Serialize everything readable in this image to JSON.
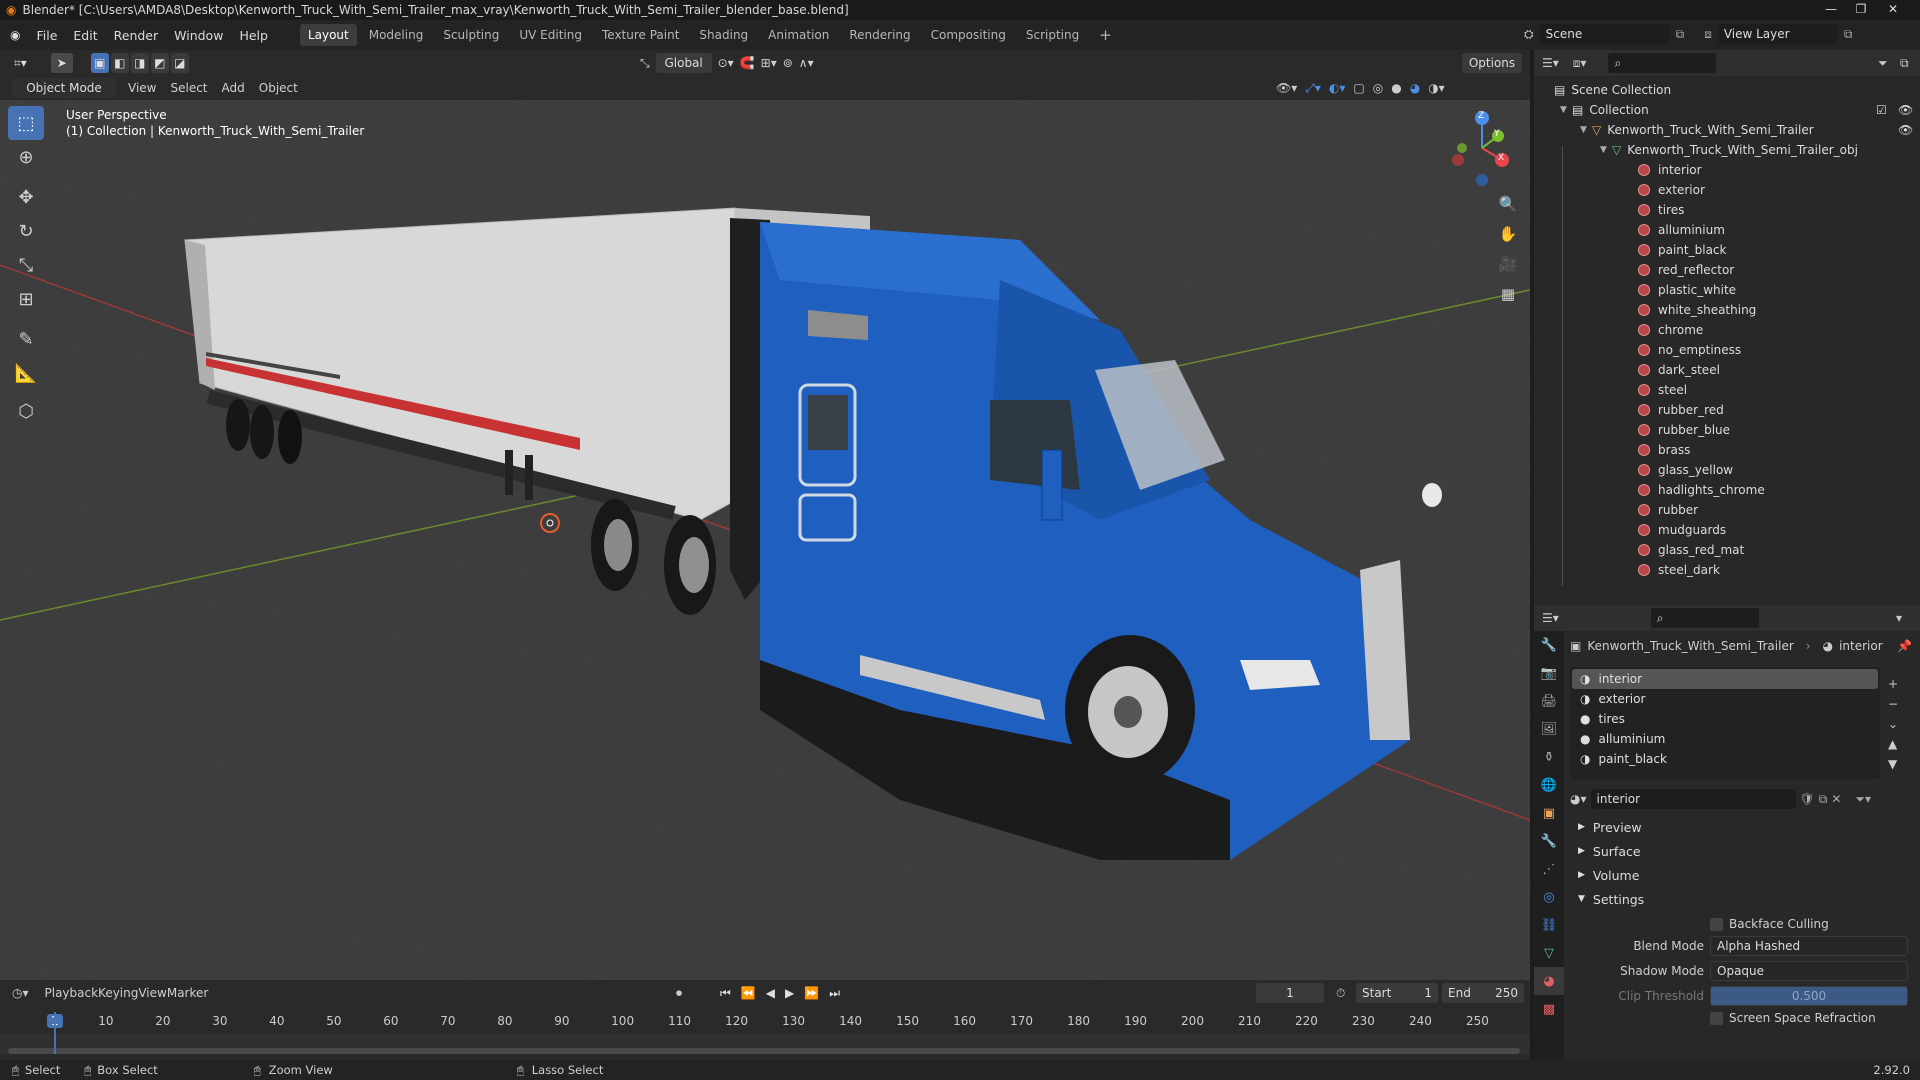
{
  "window": {
    "title": "Blender* [C:\\Users\\AMDA8\\Desktop\\Kenworth_Truck_With_Semi_Trailer_max_vray\\Kenworth_Truck_With_Semi_Trailer_blender_base.blend]"
  },
  "menu": {
    "items": [
      "File",
      "Edit",
      "Render",
      "Window",
      "Help"
    ]
  },
  "workspaces": [
    "Layout",
    "Modeling",
    "Sculpting",
    "UV Editing",
    "Texture Paint",
    "Shading",
    "Animation",
    "Rendering",
    "Compositing",
    "Scripting"
  ],
  "scene": {
    "label": "Scene",
    "view_layer": "View Layer"
  },
  "viewport_header": {
    "transform": "Global",
    "options": "Options",
    "mode": "Object Mode",
    "menus": [
      "View",
      "Select",
      "Add",
      "Object"
    ]
  },
  "viewport": {
    "perspective": "User Perspective",
    "collection": "(1) Collection | Kenworth_Truck_With_Semi_Trailer",
    "axes": {
      "x": "X",
      "y": "Y",
      "z": "Z"
    }
  },
  "outliner": {
    "root": "Scene Collection",
    "collection": "Collection",
    "object": "Kenworth_Truck_With_Semi_Trailer",
    "mesh": "Kenworth_Truck_With_Semi_Trailer_obj",
    "materials": [
      "interior",
      "exterior",
      "tires",
      "alluminium",
      "paint_black",
      "red_reflector",
      "plastic_white",
      "white_sheathing",
      "chrome",
      "no_emptiness",
      "dark_steel",
      "steel",
      "rubber_red",
      "rubber_blue",
      "brass",
      "glass_yellow",
      "hadlights_chrome",
      "rubber",
      "mudguards",
      "glass_red_mat",
      "steel_dark"
    ]
  },
  "properties": {
    "breadcrumb_object": "Kenworth_Truck_With_Semi_Trailer",
    "breadcrumb_material": "interior",
    "slots": [
      "interior",
      "exterior",
      "tires",
      "alluminium",
      "paint_black"
    ],
    "material_name": "interior",
    "panels": {
      "preview": "Preview",
      "surface": "Surface",
      "volume": "Volume",
      "settings": "Settings"
    },
    "settings": {
      "backface_culling": "Backface Culling",
      "blend_mode_label": "Blend Mode",
      "blend_mode": "Alpha Hashed",
      "shadow_mode_label": "Shadow Mode",
      "shadow_mode": "Opaque",
      "clip_threshold_label": "Clip Threshold",
      "clip_threshold": "0.500",
      "ssr": "Screen Space Refraction"
    }
  },
  "timeline": {
    "menus": [
      "Playback",
      "Keying",
      "View",
      "Marker"
    ],
    "current_frame": "1",
    "start_label": "Start",
    "start": "1",
    "end_label": "End",
    "end": "250",
    "ticks": [
      "1",
      "10",
      "20",
      "30",
      "40",
      "50",
      "60",
      "70",
      "80",
      "90",
      "100",
      "110",
      "120",
      "130",
      "140",
      "150",
      "160",
      "170",
      "180",
      "190",
      "200",
      "210",
      "220",
      "230",
      "240",
      "250"
    ]
  },
  "status": {
    "select": "Select",
    "box_select": "Box Select",
    "zoom_view": "Zoom View",
    "lasso_select": "Lasso Select",
    "version": "2.92.0"
  },
  "colors": {
    "accent": "#4772b3",
    "truck_blue": "#1f5fbf",
    "material": "#b9484b"
  }
}
